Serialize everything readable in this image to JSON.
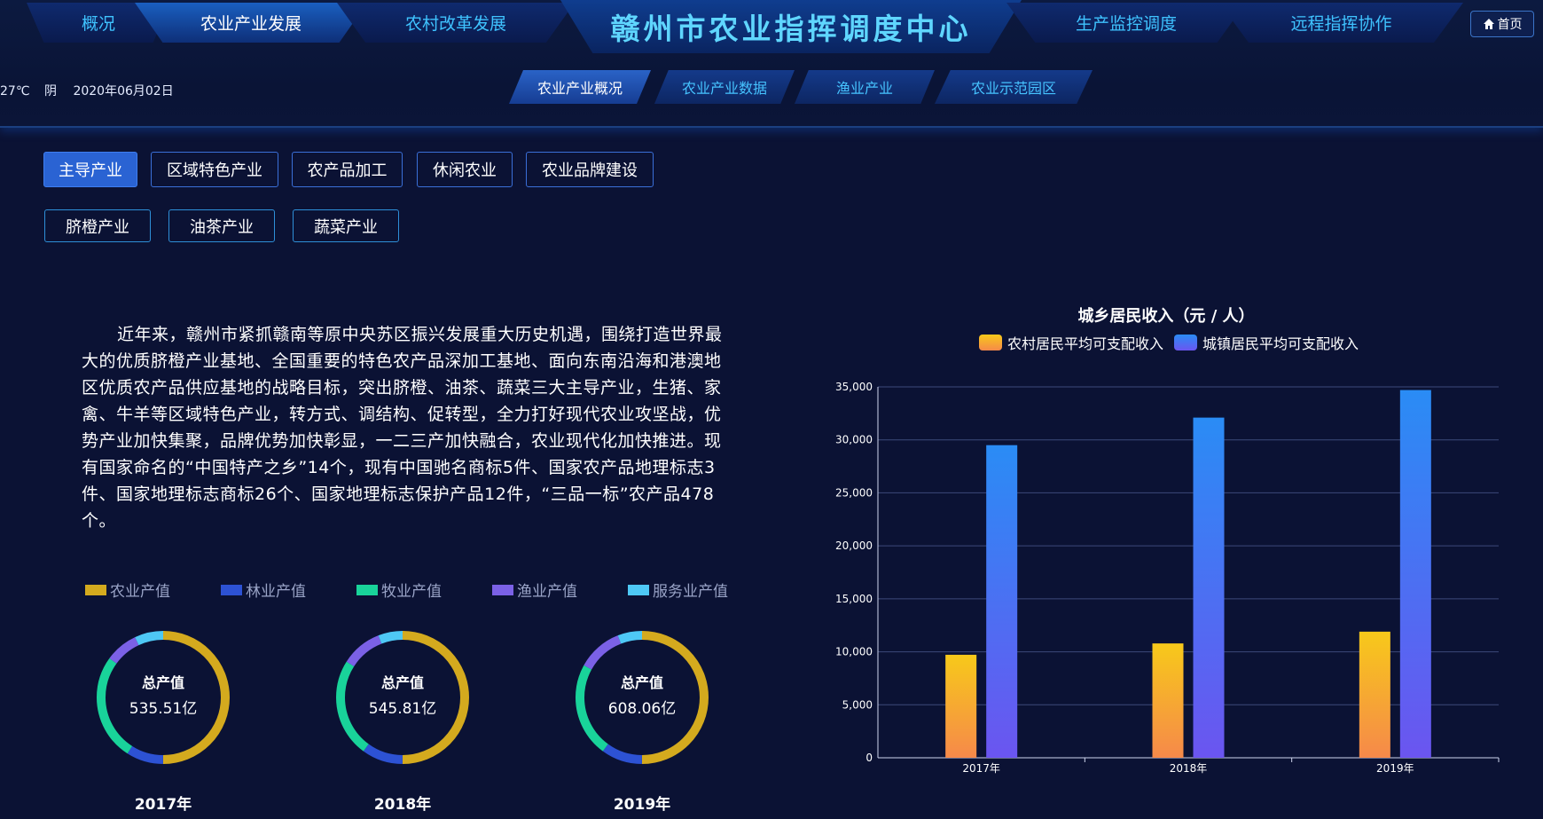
{
  "header": {
    "title": "赣州市农业指挥调度中心",
    "nav_left": [
      "概况",
      "农业产业发展",
      "农村改革发展"
    ],
    "nav_right": [
      "生产监控调度",
      "远程指挥协作"
    ],
    "home_label": "首页",
    "weather": {
      "temp": "27℃",
      "condition": "阴",
      "date": "2020年06月02日"
    }
  },
  "subnav": [
    "农业产业概况",
    "农业产业数据",
    "渔业产业",
    "农业示范园区"
  ],
  "categories_row1": [
    "主导产业",
    "区域特色产业",
    "农产品加工",
    "休闲农业",
    "农业品牌建设"
  ],
  "categories_row2": [
    "脐橙产业",
    "油茶产业",
    "蔬菜产业"
  ],
  "intro_text": "近年来，赣州市紧抓赣南等原中央苏区振兴发展重大历史机遇，围绕打造世界最大的优质脐橙产业基地、全国重要的特色农产品深加工基地、面向东南沿海和港澳地区优质农产品供应基地的战略目标，突出脐橙、油茶、蔬菜三大主导产业，生猪、家禽、牛羊等区域特色产业，转方式、调结构、促转型，全力打好现代农业攻坚战，优势产业加快集聚，品牌优势加快彰显，一二三产加快融合，农业现代化加快推进。现有国家命名的“中国特产之乡”14个，现有中国驰名商标5件、国家农产品地理标志3件、国家地理标志商标26个、国家地理标志保护产品12件，“三品一标”农产品478个。",
  "donut_legend": [
    {
      "label": "农业产值",
      "color": "#d4aa1e"
    },
    {
      "label": "林业产值",
      "color": "#2d52d4"
    },
    {
      "label": "牧业产值",
      "color": "#19d39a"
    },
    {
      "label": "渔业产值",
      "color": "#7b61e6"
    },
    {
      "label": "服务业产值",
      "color": "#4ec8f5"
    }
  ],
  "donuts": [
    {
      "year": "2017年",
      "label": "总产值",
      "value": "535.51亿"
    },
    {
      "year": "2018年",
      "label": "总产值",
      "value": "545.81亿"
    },
    {
      "year": "2019年",
      "label": "总产值",
      "value": "608.06亿"
    }
  ],
  "chart_data": {
    "type": "bar",
    "title": "城乡居民收入（元 / 人）",
    "categories": [
      "2017年",
      "2018年",
      "2019年"
    ],
    "series": [
      {
        "name": "农村居民平均可支配收入",
        "values": [
          9720,
          10790,
          11900
        ],
        "color_top": "#f7c91a",
        "color_bottom": "#f6894a"
      },
      {
        "name": "城镇居民平均可支配收入",
        "values": [
          29500,
          32100,
          34700
        ],
        "color_top": "#2a8cf5",
        "color_bottom": "#6b55f0"
      }
    ],
    "ylim": [
      0,
      35000
    ],
    "yticks": [
      "0",
      "5,000",
      "10,000",
      "15,000",
      "20,000",
      "25,000",
      "30,000",
      "35,000"
    ],
    "grid": true,
    "legend": "top-center"
  }
}
